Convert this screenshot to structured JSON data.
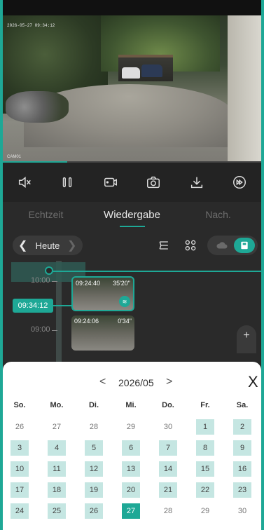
{
  "video": {
    "timestamp": "2026-05-27 09:34:12",
    "camera_label": "CAM01",
    "progress_fraction": 0.25
  },
  "controls": [
    {
      "name": "mute-icon"
    },
    {
      "name": "pause-icon"
    },
    {
      "name": "record-icon"
    },
    {
      "name": "camera-icon"
    },
    {
      "name": "download-icon"
    },
    {
      "name": "fast-forward-icon"
    }
  ],
  "tabs": [
    {
      "label": "Echtzeit",
      "active": false
    },
    {
      "label": "Wiedergabe",
      "active": true
    },
    {
      "label": "Nach.",
      "active": false
    }
  ],
  "daybar": {
    "label": "Heute"
  },
  "timeline": {
    "hours": [
      "10:00",
      "09:00"
    ],
    "current_time": "09:34:12",
    "clips": [
      {
        "time": "09:24:40",
        "duration": "35'20\"",
        "active": true
      },
      {
        "time": "09:24:06",
        "duration": "0'34\"",
        "active": false
      }
    ],
    "zoom_label": "+"
  },
  "calendar": {
    "title": "2026/05",
    "prev": "<",
    "next": ">",
    "close": "X",
    "weekdays": [
      "So.",
      "Mo.",
      "Di.",
      "Mi.",
      "Do.",
      "Fr.",
      "Sa."
    ],
    "weeks": [
      [
        {
          "d": "26",
          "s": "plain"
        },
        {
          "d": "27",
          "s": "plain"
        },
        {
          "d": "28",
          "s": "plain"
        },
        {
          "d": "29",
          "s": "plain"
        },
        {
          "d": "30",
          "s": "plain"
        },
        {
          "d": "1",
          "s": "rec"
        },
        {
          "d": "2",
          "s": "rec"
        }
      ],
      [
        {
          "d": "3",
          "s": "rec"
        },
        {
          "d": "4",
          "s": "rec"
        },
        {
          "d": "5",
          "s": "rec"
        },
        {
          "d": "6",
          "s": "rec"
        },
        {
          "d": "7",
          "s": "rec"
        },
        {
          "d": "8",
          "s": "rec"
        },
        {
          "d": "9",
          "s": "rec"
        }
      ],
      [
        {
          "d": "10",
          "s": "rec"
        },
        {
          "d": "11",
          "s": "rec"
        },
        {
          "d": "12",
          "s": "rec"
        },
        {
          "d": "13",
          "s": "rec"
        },
        {
          "d": "14",
          "s": "rec"
        },
        {
          "d": "15",
          "s": "rec"
        },
        {
          "d": "16",
          "s": "rec"
        }
      ],
      [
        {
          "d": "17",
          "s": "rec"
        },
        {
          "d": "18",
          "s": "rec"
        },
        {
          "d": "19",
          "s": "rec"
        },
        {
          "d": "20",
          "s": "rec"
        },
        {
          "d": "21",
          "s": "rec"
        },
        {
          "d": "22",
          "s": "rec"
        },
        {
          "d": "23",
          "s": "rec"
        }
      ],
      [
        {
          "d": "24",
          "s": "rec"
        },
        {
          "d": "25",
          "s": "rec"
        },
        {
          "d": "26",
          "s": "rec"
        },
        {
          "d": "27",
          "s": "sel"
        },
        {
          "d": "28",
          "s": "plain"
        },
        {
          "d": "29",
          "s": "plain"
        },
        {
          "d": "30",
          "s": "plain"
        }
      ]
    ]
  },
  "colors": {
    "accent": "#1ea896",
    "recorded_day": "#c5e6e2",
    "background": "#2a2a2a"
  }
}
